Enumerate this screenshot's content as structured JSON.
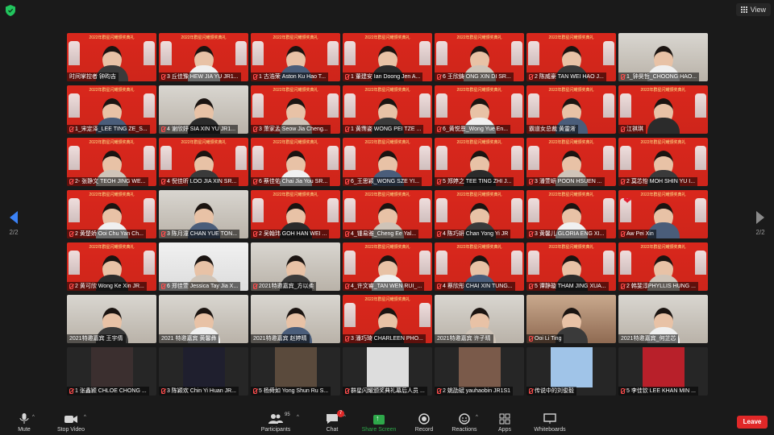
{
  "topbar": {
    "view_label": "View"
  },
  "pager": {
    "left_page": "2/2",
    "right_page": "2/2"
  },
  "banner_text": "2022年群星闪耀颁奖典礼",
  "tiles": [
    {
      "name": "时间掌控者 钟昀吉",
      "bg": "red",
      "muted": false
    },
    {
      "name": "3 丘佳豫 HEW JIA YU JR1...",
      "bg": "red",
      "muted": true
    },
    {
      "name": "1 古浩荣 Aston Ku Hao T...",
      "bg": "red",
      "muted": true
    },
    {
      "name": "1 董建安 Ian Doong Jen A...",
      "bg": "red",
      "muted": true
    },
    {
      "name": "6 王欣鋳 ONG XIN DI SR...",
      "bg": "red",
      "muted": true
    },
    {
      "name": "2 陈威豪 TAN WEI HAO J...",
      "bg": "red",
      "muted": true
    },
    {
      "name": "1_钟昊哲_CHOONG HAO...",
      "bg": "room",
      "muted": true
    },
    {
      "name": "1_宋定泽_LEE TING ZE_S...",
      "bg": "red",
      "muted": true
    },
    {
      "name": "4 谢欣妤 SIA XIN YU JR1...",
      "bg": "room",
      "muted": true
    },
    {
      "name": "3 萧家孟 Seow Jia Cheng...",
      "bg": "red",
      "muted": true
    },
    {
      "name": "1 黄霈姿 WONG PEI TZE ...",
      "bg": "red",
      "muted": true
    },
    {
      "name": "6_黄悦恩_Wong Yue En...",
      "bg": "red",
      "muted": true
    },
    {
      "name": "霸道女总裁 黄靈淅",
      "bg": "red",
      "muted": false
    },
    {
      "name": "江祺琪",
      "bg": "red",
      "muted": true
    },
    {
      "name": "2- 张静文 TEOH JING WE...",
      "bg": "red",
      "muted": true
    },
    {
      "name": "4 倪佳昕 LOO JIA XIN SR...",
      "bg": "red",
      "muted": true
    },
    {
      "name": "6 蔡佳佑 Chai Jia You SR...",
      "bg": "red",
      "muted": true
    },
    {
      "name": "6_王思颖_WONG SZE YI...",
      "bg": "red",
      "muted": true
    },
    {
      "name": "5 郑婷之 TEE TING ZHI J...",
      "bg": "red",
      "muted": true
    },
    {
      "name": "3 潘萱岍 POON HSUEN ...",
      "bg": "red",
      "muted": true
    },
    {
      "name": "2 莫芯怡 MOH SHIN YU I...",
      "bg": "red",
      "muted": true
    },
    {
      "name": "2 黄楚娇 Ooi Chu Yan Ch...",
      "bg": "red",
      "muted": true
    },
    {
      "name": "3 陈月潼 CHAN YUE TON...",
      "bg": "room",
      "muted": true
    },
    {
      "name": "2 吴翰玮 GOH HAN WEI ...",
      "bg": "red",
      "muted": true
    },
    {
      "name": "4_锺易雅_Cheng Ee Yal...",
      "bg": "red",
      "muted": true
    },
    {
      "name": "4 陈巧妍 Chan Yong Yi JR",
      "bg": "red",
      "muted": true
    },
    {
      "name": "3 黄馨儿 GLORIA ENG XI...",
      "bg": "red",
      "muted": true
    },
    {
      "name": "Aw Pei Xin",
      "bg": "red",
      "muted": true,
      "heart": true
    },
    {
      "name": "2 黄可欣 Wong Ke Xin JR...",
      "bg": "red",
      "muted": true
    },
    {
      "name": "6 郑佳萱 Jessica Tay Jia X...",
      "bg": "white",
      "muted": true
    },
    {
      "name": "2021特邀嘉宾_方以柔",
      "bg": "room",
      "muted": true
    },
    {
      "name": "4_许文睿_TAN WEN RUI_...",
      "bg": "red",
      "muted": true
    },
    {
      "name": "4 蔡欣彤 CHAI XIN TUNG...",
      "bg": "red",
      "muted": true
    },
    {
      "name": "5 谭静璇 THAM JING XUA...",
      "bg": "red",
      "muted": true
    },
    {
      "name": "2 韩斐淳PHYLLIS HUNG ...",
      "bg": "red",
      "muted": true
    },
    {
      "name": "2021特邀嘉宾 王宇倩",
      "bg": "room",
      "muted": false
    },
    {
      "name": "2021 特邀嘉宾 黄馨彝",
      "bg": "room",
      "muted": false
    },
    {
      "name": "2021特邀嘉宾 赵婷晴",
      "bg": "room",
      "muted": false
    },
    {
      "name": "3 潘巧琦 CHARLEEN PHO...",
      "bg": "red",
      "muted": true
    },
    {
      "name": "2021特邀嘉宾 许子晴",
      "bg": "room",
      "muted": false
    },
    {
      "name": "Ooi Li Ting",
      "bg": "warm",
      "muted": true
    },
    {
      "name": "2021特邀嘉宾_何芷芯",
      "bg": "room",
      "muted": false
    },
    {
      "name": "1 张鑫颍 CHLOE CHONG ...",
      "bg": "dark",
      "muted": true
    },
    {
      "name": "3 陈颖欢 Chin Yi Huan JR...",
      "bg": "dark",
      "muted": true
    },
    {
      "name": "5 杨舜如 Yong Shun Ru S...",
      "bg": "dark",
      "muted": true
    },
    {
      "name": "群星闪耀颁奖典礼幕后人员 ...",
      "bg": "dark",
      "muted": true
    },
    {
      "name": "2 姚劭斌 yauhaobin JR1S1",
      "bg": "dark",
      "muted": true
    },
    {
      "name": "传说中的刘俊毅",
      "bg": "dark",
      "muted": true
    },
    {
      "name": "5 李佳钦 LEE KHAN MIN ...",
      "bg": "dark",
      "muted": true
    }
  ],
  "toolbar": {
    "mute_label": "Mute",
    "video_label": "Stop Video",
    "participants_label": "Participants",
    "participants_count": "95",
    "chat_label": "Chat",
    "chat_badge": "7",
    "share_label": "Share Screen",
    "record_label": "Record",
    "reactions_label": "Reactions",
    "apps_label": "Apps",
    "whiteboards_label": "Whiteboards",
    "leave_label": "Leave"
  },
  "colors": {
    "accent_green": "#2ea84a",
    "leave_red": "#e02828",
    "pager_blue": "#3b82f6",
    "banner_red": "#d9271c"
  }
}
